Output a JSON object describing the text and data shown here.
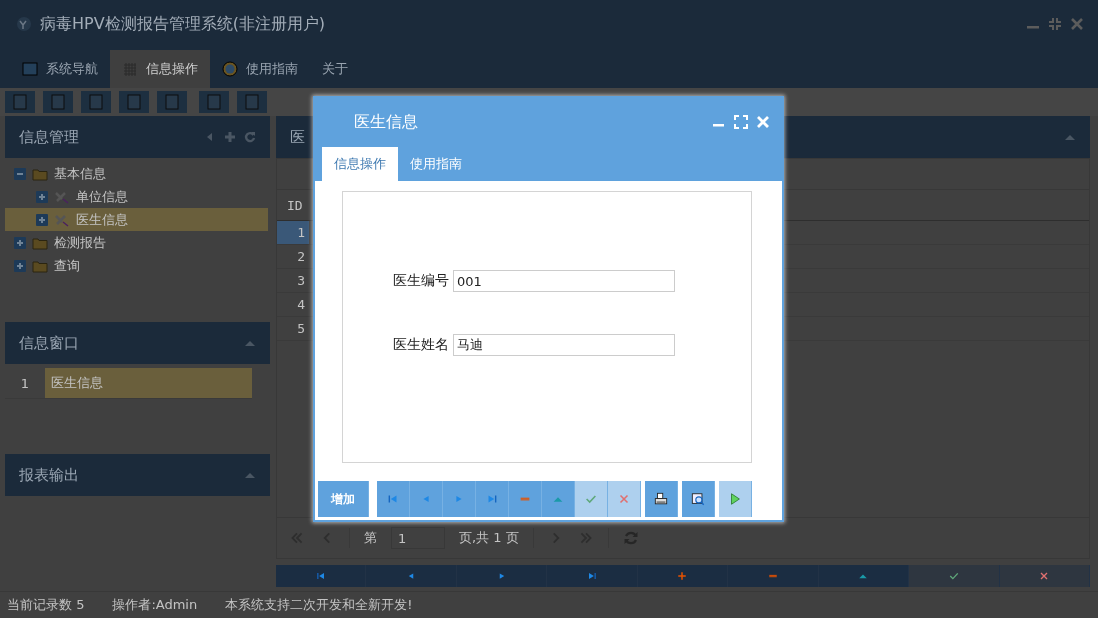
{
  "window": {
    "title": "病毒HPV检测报告管理系统(非注册用户)"
  },
  "menu_tabs": [
    {
      "label": "系统导航",
      "kind": "nav",
      "selected": false
    },
    {
      "label": "信息操作",
      "kind": "grid",
      "selected": true
    },
    {
      "label": "使用指南",
      "kind": "help",
      "selected": false
    },
    {
      "label": "关于",
      "kind": "plain",
      "selected": false
    }
  ],
  "tree_panel": {
    "title": "信息管理",
    "items": [
      {
        "label": "基本信息",
        "kind": "folder",
        "expanded": true,
        "selected": false,
        "children": [
          {
            "label": "单位信息",
            "kind": "tool",
            "expanded": false,
            "selected": false
          },
          {
            "label": "医生信息",
            "kind": "tool",
            "expanded": false,
            "selected": true
          }
        ]
      },
      {
        "label": "检测报告",
        "kind": "folder",
        "expanded": false,
        "selected": false
      },
      {
        "label": "查询",
        "kind": "folder",
        "expanded": false,
        "selected": false
      }
    ]
  },
  "window_panel": {
    "title": "信息窗口",
    "rows": [
      {
        "index": "1",
        "label": "医生信息",
        "selected": true
      }
    ]
  },
  "report_panel": {
    "title": "报表输出"
  },
  "main_panel": {
    "title": "医",
    "grid": {
      "columns": [
        "ID"
      ],
      "rows": [
        {
          "id": "1",
          "selected": true
        },
        {
          "id": "2",
          "selected": false
        },
        {
          "id": "3",
          "selected": false
        },
        {
          "id": "4",
          "selected": false
        },
        {
          "id": "5",
          "selected": false
        }
      ]
    },
    "pager": {
      "prefix": "第",
      "page": "1",
      "suffix": "页,共 1 页"
    },
    "action_bar": [
      {
        "kind": "first",
        "disabled": false
      },
      {
        "kind": "prev",
        "disabled": false
      },
      {
        "kind": "next",
        "disabled": false
      },
      {
        "kind": "last",
        "disabled": false
      },
      {
        "kind": "add",
        "disabled": false
      },
      {
        "kind": "delete",
        "disabled": false
      },
      {
        "kind": "up",
        "disabled": false
      },
      {
        "kind": "save",
        "disabled": true
      },
      {
        "kind": "cancel",
        "disabled": true
      }
    ]
  },
  "status_bar": [
    "当前记录数 5",
    "操作者:Admin",
    "本系统支持二次开发和全新开发!"
  ],
  "dialog": {
    "title": "医生信息",
    "tabs": [
      {
        "label": "信息操作",
        "selected": true
      },
      {
        "label": "使用指南",
        "selected": false
      }
    ],
    "fields": [
      {
        "label": "医生编号",
        "value": "001"
      },
      {
        "label": "医生姓名",
        "value": "马迪"
      }
    ],
    "buttons": [
      {
        "kind": "text",
        "label": "增加",
        "disabled": false
      },
      {
        "kind": "first",
        "disabled": false
      },
      {
        "kind": "prev",
        "disabled": false
      },
      {
        "kind": "next",
        "disabled": false
      },
      {
        "kind": "last",
        "disabled": false
      },
      {
        "kind": "delete",
        "disabled": false
      },
      {
        "kind": "up",
        "disabled": false
      },
      {
        "kind": "save",
        "disabled": true
      },
      {
        "kind": "cancel",
        "disabled": true
      },
      {
        "kind": "print",
        "disabled": false
      },
      {
        "kind": "preview",
        "disabled": false
      },
      {
        "kind": "run",
        "disabled": true
      }
    ]
  }
}
